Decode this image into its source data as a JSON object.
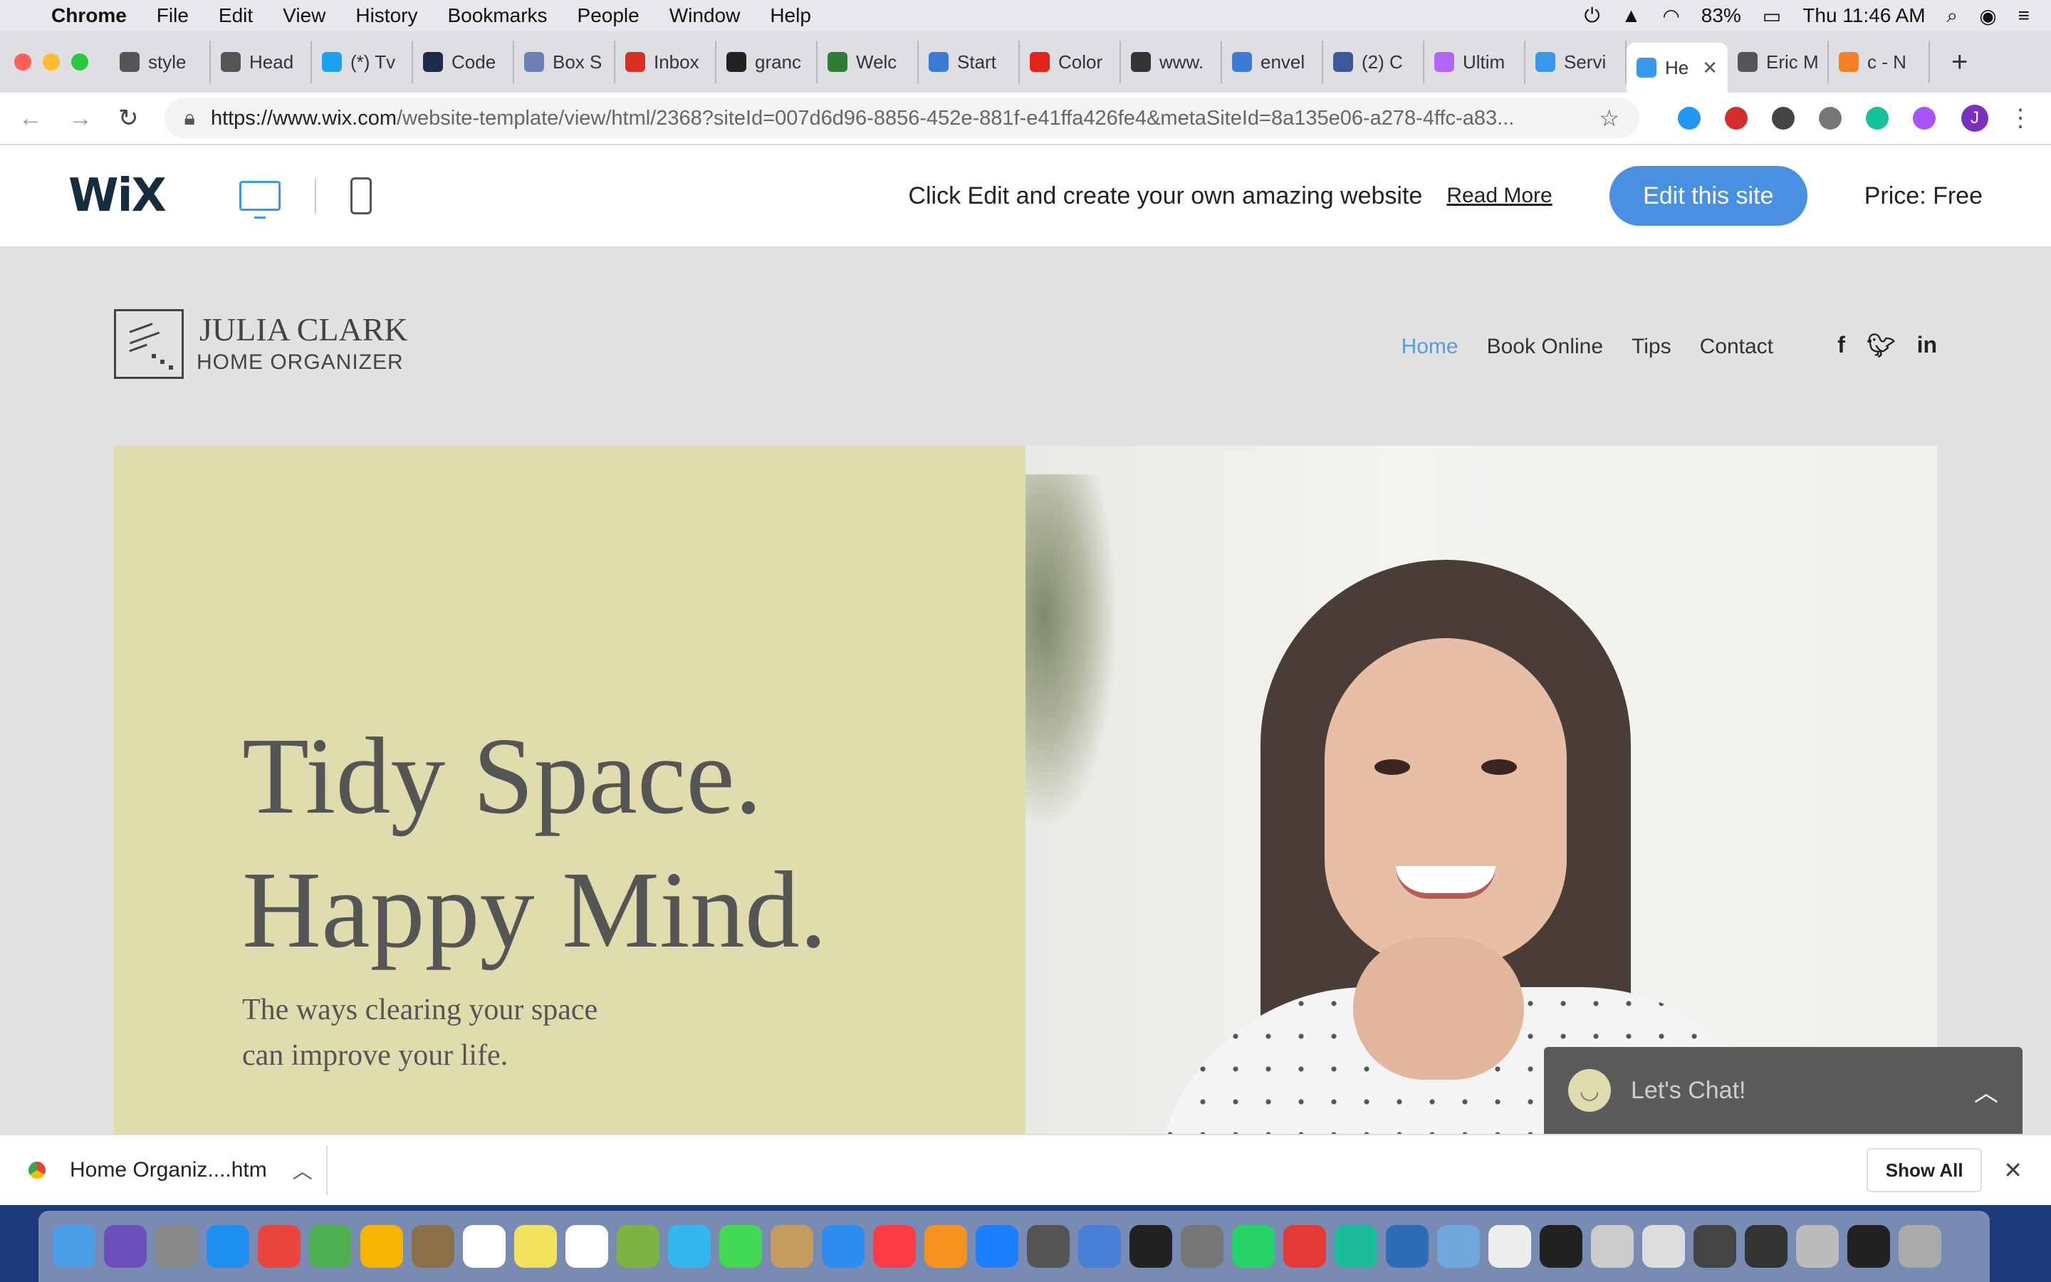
{
  "menubar": {
    "app": "Chrome",
    "items": [
      "File",
      "Edit",
      "View",
      "History",
      "Bookmarks",
      "People",
      "Window",
      "Help"
    ],
    "battery": "83%",
    "clock": "Thu 11:46 AM"
  },
  "tabs": [
    {
      "label": "style",
      "color": "#555555"
    },
    {
      "label": "Head",
      "color": "#555555"
    },
    {
      "label": "(*) Tv",
      "color": "#1da1f2"
    },
    {
      "label": "Code",
      "color": "#1e2a4a"
    },
    {
      "label": "Box S",
      "color": "#6f7fb5"
    },
    {
      "label": "Inbox",
      "color": "#d93025"
    },
    {
      "label": "granc",
      "color": "#222222"
    },
    {
      "label": "Welc",
      "color": "#2e7d32"
    },
    {
      "label": "Start",
      "color": "#3a7bd5"
    },
    {
      "label": "Color",
      "color": "#e1251b"
    },
    {
      "label": "www.",
      "color": "#333333"
    },
    {
      "label": "envel",
      "color": "#3a7bd5"
    },
    {
      "label": "(2) C",
      "color": "#3b5998"
    },
    {
      "label": "Ultim",
      "color": "#b266ff"
    },
    {
      "label": "Servi",
      "color": "#3899ec"
    },
    {
      "label": "He",
      "color": "#3899ec",
      "active": true
    },
    {
      "label": "Eric M",
      "color": "#555555"
    },
    {
      "label": "c - N",
      "color": "#f48024"
    }
  ],
  "address": {
    "host": "https://www.wix.com",
    "path": "/website-template/view/html/2368?siteId=007d6d96-8856-452e-881f-e41ffa426fe4&metaSiteId=8a135e06-a278-4ffc-a83..."
  },
  "profile_initial": "J",
  "wix": {
    "logo": "WiX",
    "message": "Click Edit and create your own amazing website",
    "read_more": "Read More",
    "edit_button": "Edit this site",
    "price": "Price: Free"
  },
  "site": {
    "name": "JULIA CLARK",
    "subtitle": "HOME ORGANIZER",
    "nav": [
      "Home",
      "Book Online",
      "Tips",
      "Contact"
    ],
    "social": [
      "f",
      "t",
      "in"
    ],
    "hero_line1": "Tidy Space.",
    "hero_line2": "Happy Mind.",
    "hero_sub1": "The ways clearing your space",
    "hero_sub2": "can improve your life.",
    "hero_color": "#dfdcae",
    "nav_active_color": "#5b9bd5"
  },
  "chat": {
    "label": "Let's Chat!"
  },
  "download": {
    "file": "Home Organiz....htm",
    "show_all": "Show All"
  },
  "dock_colors": [
    "#4a9fe8",
    "#6b4fbb",
    "#8a8a8a",
    "#1f8ef1",
    "#e8453c",
    "#4caf50",
    "#f4b400",
    "#8b6f47",
    "#ffffff",
    "#f2e15c",
    "#ffffff",
    "#7cb342",
    "#34b7f1",
    "#43d854",
    "#c59b5f",
    "#2d8cf0",
    "#fc3c44",
    "#f7931e",
    "#1d7dff",
    "#555555",
    "#4a7fd6",
    "#222222",
    "#777777",
    "#25d366",
    "#e53935",
    "#1abc9c",
    "#2c6db5",
    "#6fa8dc",
    "#eeeeee",
    "#222222",
    "#cccccc",
    "#dddddd",
    "#444444",
    "#333333",
    "#bbbbbb",
    "#222222",
    "#aaaaaa"
  ]
}
